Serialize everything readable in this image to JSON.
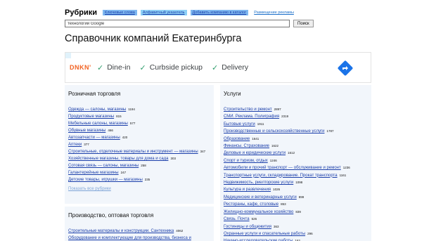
{
  "brand": "Рубрики",
  "topnav": [
    {
      "label": "Ключевые слова",
      "style": "hl"
    },
    {
      "label": "Алфавитный указатель",
      "style": "hl2"
    },
    {
      "label": "Добавить компанию в каталог",
      "style": "hl"
    },
    {
      "label": "Размещение рекламы",
      "style": "plain"
    }
  ],
  "search": {
    "value": "технологии Google",
    "button": "Поиск"
  },
  "title": "Справочник компаний Екатеринбурга",
  "ad": {
    "logo_top": "DNKN'",
    "items": [
      "Dine-in",
      "Curbside pickup",
      "Delivery"
    ],
    "accent": "#1a73e8",
    "logo_color": "#f26222"
  },
  "retail": {
    "title": "Розничная торговля",
    "items": [
      {
        "label": "Одежда — салоны, магазины",
        "count": "1194"
      },
      {
        "label": "Продуктовые магазины",
        "count": "815"
      },
      {
        "label": "Мебельные салоны, магазины",
        "count": "577"
      },
      {
        "label": "Обувные магазины",
        "count": "466"
      },
      {
        "label": "Автозапчасти — магазины",
        "count": "420"
      },
      {
        "label": "Аптеки",
        "count": "377"
      },
      {
        "label": "Строительные, отделочные материалы и инструмент — магазины",
        "count": "347"
      },
      {
        "label": "Хозяйственные магазины, товары для дома и сада",
        "count": "303"
      },
      {
        "label": "Сотовая связь — салоны, магазины",
        "count": "258"
      },
      {
        "label": "Галантерейные магазины",
        "count": "247"
      },
      {
        "label": "Детские товары, игрушки — магазины",
        "count": "235"
      }
    ],
    "all_label": "Показать все рубрики"
  },
  "production": {
    "title": "Производство, оптовая торговля",
    "items": [
      {
        "label": "Строительные материалы и конструкции. Сантехника",
        "count": "4062"
      },
      {
        "label": "Оборудование и комплектующие для производства, бизнеса и",
        "count": ""
      }
    ]
  },
  "services": {
    "title": "Услуги",
    "items": [
      {
        "label": "Строительство и ремонт",
        "count": "2897"
      },
      {
        "label": "СМИ. Реклама. Полиграфия",
        "count": "2319"
      },
      {
        "label": "Бытовые услуги",
        "count": "1911"
      },
      {
        "label": "Производственные и сельскохозяйственные услуги",
        "count": "1787"
      },
      {
        "label": "Образование",
        "count": "1641"
      },
      {
        "label": "Финансы. Страхование",
        "count": "1622"
      },
      {
        "label": "Деловые и юридические услуги",
        "count": "1612"
      },
      {
        "label": "Спорт и туризм, отдых",
        "count": "1246"
      },
      {
        "label": "Автомобили и прочий транспорт — обслуживание и ремонт",
        "count": "1236"
      },
      {
        "label": "Транспортные услуги, складирование. Прокат транспорта",
        "count": "1161"
      },
      {
        "label": "Недвижимость, риелторские услуги",
        "count": "1098"
      },
      {
        "label": "Культура и развлечения",
        "count": "1026"
      },
      {
        "label": "Медицинские и ветеринарные услуги",
        "count": "899"
      },
      {
        "label": "Рестораны, кафе, столовые",
        "count": "853"
      },
      {
        "label": "Жилищно-коммунальное хозяйство",
        "count": "839"
      },
      {
        "label": "Связь. Почта",
        "count": "526"
      },
      {
        "label": "Гостиницы и общежития",
        "count": "363"
      },
      {
        "label": "Охранные услуги и спасательные работы",
        "count": "296"
      },
      {
        "label": "Научно-исследовательские работы",
        "count": "162"
      }
    ]
  }
}
